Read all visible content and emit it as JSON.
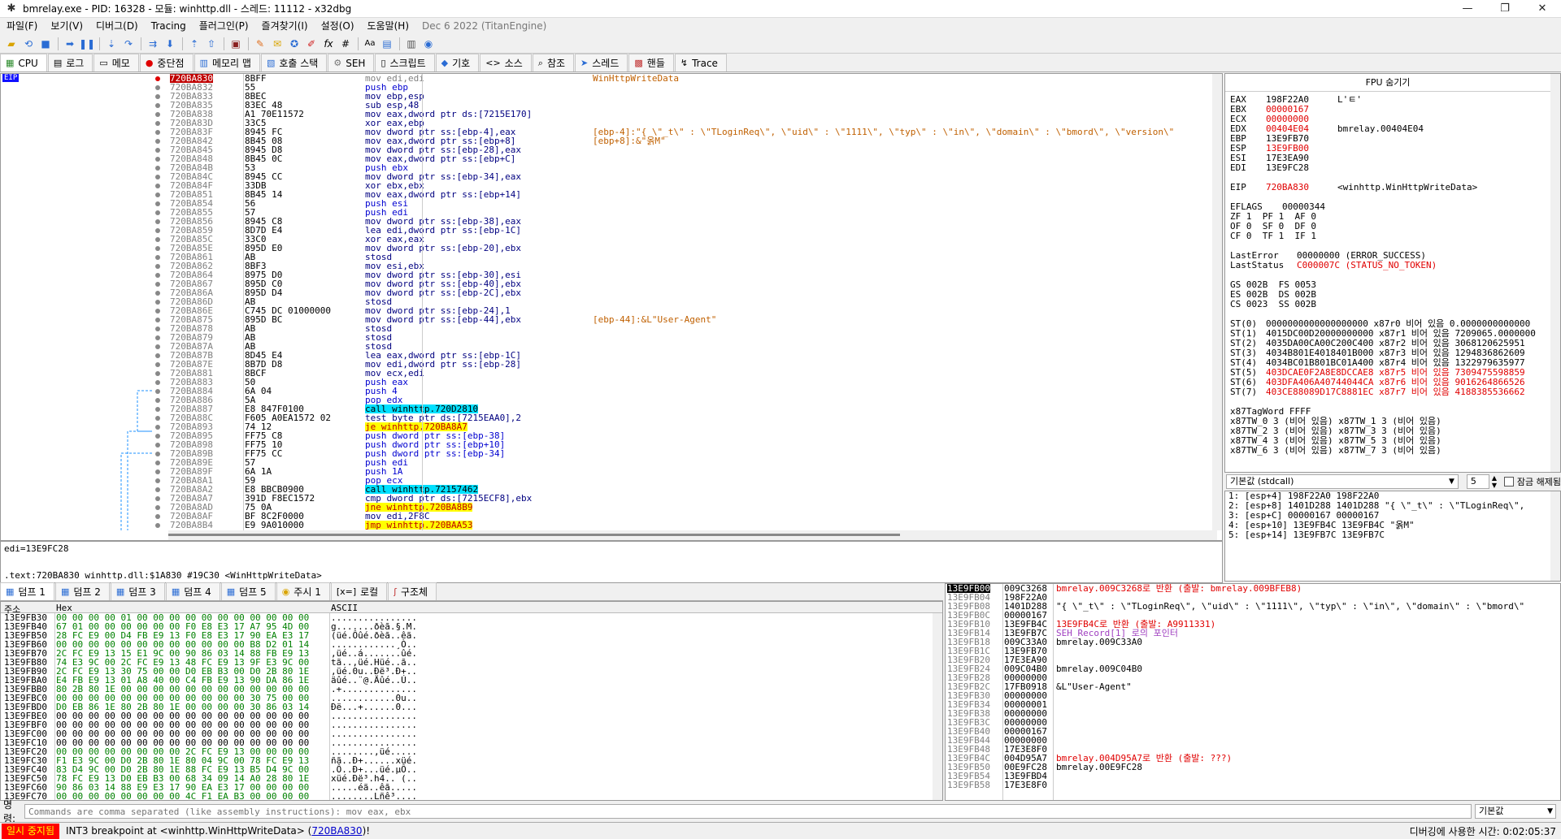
{
  "window": {
    "title": "bmrelay.exe - PID: 16328 - 모듈: winhttp.dll - 스레드: 11112 - x32dbg"
  },
  "menu": {
    "items": [
      "파일(F)",
      "보기(V)",
      "디버그(D)",
      "Tracing",
      "플러그인(P)",
      "즐겨찾기(I)",
      "설정(O)",
      "도움말(H)"
    ],
    "date": "Dec 6 2022 (TitanEngine)"
  },
  "tabs": [
    {
      "label": "CPU",
      "icon": "cpu-icon"
    },
    {
      "label": "로그",
      "icon": "log-icon"
    },
    {
      "label": "메모",
      "icon": "notes-icon"
    },
    {
      "label": "중단점",
      "icon": "breakpoint-icon"
    },
    {
      "label": "메모리 맵",
      "icon": "memory-map-icon"
    },
    {
      "label": "호출 스택",
      "icon": "call-stack-icon"
    },
    {
      "label": "SEH",
      "icon": "seh-icon"
    },
    {
      "label": "스크립트",
      "icon": "script-icon"
    },
    {
      "label": "기호",
      "icon": "symbols-icon"
    },
    {
      "label": "소스",
      "icon": "source-icon"
    },
    {
      "label": "참조",
      "icon": "references-icon"
    },
    {
      "label": "스레드",
      "icon": "threads-icon"
    },
    {
      "label": "핸들",
      "icon": "handles-icon"
    },
    {
      "label": "Trace",
      "icon": "trace-icon"
    }
  ],
  "disasm": {
    "eip_label": "EIP",
    "rows": [
      {
        "addr": "720BA830",
        "bytes": "8BFF",
        "ins": "mov edi,edi",
        "cmt": "WinHttpWriteData",
        "eip": true
      },
      {
        "addr": "720BA832",
        "bytes": "55",
        "ins": "push ebp",
        "cmt": ""
      },
      {
        "addr": "720BA833",
        "bytes": "8BEC",
        "ins": "mov ebp,esp",
        "cmt": ""
      },
      {
        "addr": "720BA835",
        "bytes": "83EC 48",
        "ins": "sub esp,48",
        "cmt": ""
      },
      {
        "addr": "720BA838",
        "bytes": "A1 70E11572",
        "ins": "mov eax,dword ptr ds:[7215E170]",
        "cmt": ""
      },
      {
        "addr": "720BA83D",
        "bytes": "33C5",
        "ins": "xor eax,ebp",
        "cmt": ""
      },
      {
        "addr": "720BA83F",
        "bytes": "8945 FC",
        "ins": "mov dword ptr ss:[ebp-4],eax",
        "cmt": "[ebp-4]:\"{ \\\"_t\\\" : \\\"TLoginReq\\\", \\\"uid\\\" : \\\"1111\\\", \\\"typ\\\" : \\\"in\\\", \\\"domain\\\" : \\\"bmord\\\", \\\"version\\\""
      },
      {
        "addr": "720BA842",
        "bytes": "8B45 08",
        "ins": "mov eax,dword ptr ss:[ebp+8]",
        "cmt": "[ebp+8]:&\"옭M\""
      },
      {
        "addr": "720BA845",
        "bytes": "8945 D8",
        "ins": "mov dword ptr ss:[ebp-28],eax",
        "cmt": ""
      },
      {
        "addr": "720BA848",
        "bytes": "8B45 0C",
        "ins": "mov eax,dword ptr ss:[ebp+C]",
        "cmt": ""
      },
      {
        "addr": "720BA84B",
        "bytes": "53",
        "ins": "push ebx",
        "cmt": ""
      },
      {
        "addr": "720BA84C",
        "bytes": "8945 CC",
        "ins": "mov dword ptr ss:[ebp-34],eax",
        "cmt": ""
      },
      {
        "addr": "720BA84F",
        "bytes": "33DB",
        "ins": "xor ebx,ebx",
        "cmt": ""
      },
      {
        "addr": "720BA851",
        "bytes": "8B45 14",
        "ins": "mov eax,dword ptr ss:[ebp+14]",
        "cmt": ""
      },
      {
        "addr": "720BA854",
        "bytes": "56",
        "ins": "push esi",
        "cmt": ""
      },
      {
        "addr": "720BA855",
        "bytes": "57",
        "ins": "push edi",
        "cmt": ""
      },
      {
        "addr": "720BA856",
        "bytes": "8945 C8",
        "ins": "mov dword ptr ss:[ebp-38],eax",
        "cmt": ""
      },
      {
        "addr": "720BA859",
        "bytes": "8D7D E4",
        "ins": "lea edi,dword ptr ss:[ebp-1C]",
        "cmt": ""
      },
      {
        "addr": "720BA85C",
        "bytes": "33C0",
        "ins": "xor eax,eax",
        "cmt": ""
      },
      {
        "addr": "720BA85E",
        "bytes": "895D E0",
        "ins": "mov dword ptr ss:[ebp-20],ebx",
        "cmt": ""
      },
      {
        "addr": "720BA861",
        "bytes": "AB",
        "ins": "stosd",
        "cmt": ""
      },
      {
        "addr": "720BA862",
        "bytes": "8BF3",
        "ins": "mov esi,ebx",
        "cmt": ""
      },
      {
        "addr": "720BA864",
        "bytes": "8975 D0",
        "ins": "mov dword ptr ss:[ebp-30],esi",
        "cmt": ""
      },
      {
        "addr": "720BA867",
        "bytes": "895D C0",
        "ins": "mov dword ptr ss:[ebp-40],ebx",
        "cmt": ""
      },
      {
        "addr": "720BA86A",
        "bytes": "895D D4",
        "ins": "mov dword ptr ss:[ebp-2C],ebx",
        "cmt": ""
      },
      {
        "addr": "720BA86D",
        "bytes": "AB",
        "ins": "stosd",
        "cmt": ""
      },
      {
        "addr": "720BA86E",
        "bytes": "C745 DC 01000000",
        "ins": "mov dword ptr ss:[ebp-24],1",
        "cmt": ""
      },
      {
        "addr": "720BA875",
        "bytes": "895D BC",
        "ins": "mov dword ptr ss:[ebp-44],ebx",
        "cmt": "[ebp-44]:&L\"User-Agent\""
      },
      {
        "addr": "720BA878",
        "bytes": "AB",
        "ins": "stosd",
        "cmt": ""
      },
      {
        "addr": "720BA879",
        "bytes": "AB",
        "ins": "stosd",
        "cmt": ""
      },
      {
        "addr": "720BA87A",
        "bytes": "AB",
        "ins": "stosd",
        "cmt": ""
      },
      {
        "addr": "720BA87B",
        "bytes": "8D45 E4",
        "ins": "lea eax,dword ptr ss:[ebp-1C]",
        "cmt": ""
      },
      {
        "addr": "720BA87E",
        "bytes": "8B7D D8",
        "ins": "mov edi,dword ptr ss:[ebp-28]",
        "cmt": ""
      },
      {
        "addr": "720BA881",
        "bytes": "8BCF",
        "ins": "mov ecx,edi",
        "cmt": ""
      },
      {
        "addr": "720BA883",
        "bytes": "50",
        "ins": "push eax",
        "cmt": ""
      },
      {
        "addr": "720BA884",
        "bytes": "6A 04",
        "ins": "push 4",
        "cmt": ""
      },
      {
        "addr": "720BA886",
        "bytes": "5A",
        "ins": "pop edx",
        "cmt": ""
      },
      {
        "addr": "720BA887",
        "bytes": "E8 847F0100",
        "ins": "call winhttp.720D2810",
        "cmt": "",
        "kind": "call"
      },
      {
        "addr": "720BA88C",
        "bytes": "F605 A0EA1572 02",
        "ins": "test byte ptr ds:[7215EAA0],2",
        "cmt": ""
      },
      {
        "addr": "720BA893",
        "bytes": "74 12",
        "ins": "je winhttp.720BA8A7",
        "cmt": "",
        "kind": "jmp"
      },
      {
        "addr": "720BA895",
        "bytes": "FF75 C8",
        "ins": "push dword ptr ss:[ebp-38]",
        "cmt": ""
      },
      {
        "addr": "720BA898",
        "bytes": "FF75 10",
        "ins": "push dword ptr ss:[ebp+10]",
        "cmt": ""
      },
      {
        "addr": "720BA89B",
        "bytes": "FF75 CC",
        "ins": "push dword ptr ss:[ebp-34]",
        "cmt": ""
      },
      {
        "addr": "720BA89E",
        "bytes": "57",
        "ins": "push edi",
        "cmt": ""
      },
      {
        "addr": "720BA89F",
        "bytes": "6A 1A",
        "ins": "push 1A",
        "cmt": ""
      },
      {
        "addr": "720BA8A1",
        "bytes": "59",
        "ins": "pop ecx",
        "cmt": ""
      },
      {
        "addr": "720BA8A2",
        "bytes": "E8 BBCB0900",
        "ins": "call winhttp.72157462",
        "cmt": "",
        "kind": "call"
      },
      {
        "addr": "720BA8A7",
        "bytes": "391D F8EC1572",
        "ins": "cmp dword ptr ds:[7215ECF8],ebx",
        "cmt": ""
      },
      {
        "addr": "720BA8AD",
        "bytes": "75 0A",
        "ins": "jne winhttp.720BA8B9",
        "cmt": "",
        "kind": "jmp"
      },
      {
        "addr": "720BA8AF",
        "bytes": "BF 8C2F0000",
        "ins": "mov edi,2F8C",
        "cmt": ""
      },
      {
        "addr": "720BA8B4",
        "bytes": "E9 9A010000",
        "ins": "jmp winhttp.720BAA53",
        "cmt": "",
        "kind": "jmp"
      }
    ]
  },
  "info": {
    "line1": "edi=13E9FC28",
    "line2": ".text:720BA830 winhttp.dll:$1A830 #19C30 <WinHttpWriteData>"
  },
  "regs": {
    "header": "FPU 숨기기",
    "lines": [
      {
        "name": "EAX",
        "val": "198F22A0",
        "cmt": "L'ㅌ'",
        "red": false
      },
      {
        "name": "EBX",
        "val": "00000167",
        "cmt": "",
        "red": true
      },
      {
        "name": "ECX",
        "val": "00000000",
        "cmt": "",
        "red": true
      },
      {
        "name": "EDX",
        "val": "00404E04",
        "cmt": "bmrelay.00404E04",
        "red": true
      },
      {
        "name": "EBP",
        "val": "13E9FB70",
        "cmt": "",
        "red": false
      },
      {
        "name": "ESP",
        "val": "13E9FB00",
        "cmt": "",
        "red": true
      },
      {
        "name": "ESI",
        "val": "17E3EA90",
        "cmt": "",
        "red": false
      },
      {
        "name": "EDI",
        "val": "13E9FC28",
        "cmt": "",
        "red": false
      },
      {
        "name": "",
        "val": "",
        "cmt": "",
        "red": false
      },
      {
        "name": "EIP",
        "val": "720BA830",
        "cmt": "<winhttp.WinHttpWriteData>",
        "red": true
      }
    ],
    "eflags": {
      "label": "EFLAGS",
      "val": "00000344"
    },
    "flags": [
      "ZF 1  PF 1  AF 0",
      "OF 0  SF 0  DF 0",
      "CF 0  TF 1  IF 1"
    ],
    "lasterror": {
      "label": "LastError",
      "val": "00000000 (ERROR_SUCCESS)"
    },
    "laststatus": {
      "label": "LastStatus",
      "val": "C000007C (STATUS_NO_TOKEN)"
    },
    "segs": [
      "GS 002B  FS 0053",
      "ES 002B  DS 002B",
      "CS 0023  SS 002B"
    ],
    "st": [
      {
        "val": "0000000000000000000 x87r0 비어 있음 0.0000000000000",
        "red": false
      },
      {
        "val": "4015DC00D20000000000 x87r1 비어 있음 7209065.0000000",
        "red": false
      },
      {
        "val": "4035DA00CA00C200C400 x87r2 비어 있음 3068120625951",
        "red": false
      },
      {
        "val": "4034B801E4018401B000 x87r3 비어 있음 1294836862609",
        "red": false
      },
      {
        "val": "4034BC01B801BC01A400 x87r4 비어 있음 1322979635977",
        "red": false
      },
      {
        "val": "403DCAE0F2A8E8DCCAE8 x87r5 비어 있음 7309475598859",
        "red": true
      },
      {
        "val": "403DFA406A40744044CA x87r6 비어 있음 9016264866526",
        "red": true
      },
      {
        "val": "403CE88089D17C8881EC x87r7 비어 있음 4188385536662",
        "red": true
      }
    ],
    "tagword": "x87TagWord FFFF",
    "tw": [
      "x87TW_0 3 (비어 있음) x87TW_1 3 (비어 있음)",
      "x87TW_2 3 (비어 있음) x87TW_3 3 (비어 있음)",
      "x87TW_4 3 (비어 있음) x87TW_5 3 (비어 있음)",
      "x87TW_6 3 (비어 있음) x87TW_7 3 (비어 있음)"
    ]
  },
  "callconv": {
    "selected": "기본값 (stdcall)",
    "count": "5",
    "lock_label": "잠금 해제됨"
  },
  "args": [
    "1: [esp+4] 198F22A0 198F22A0",
    "2: [esp+8] 1401D288 1401D288 \"{ \\\"_t\\\" : \\\"TLoginReq\\\",",
    "3: [esp+C] 00000167 00000167",
    "4: [esp+10] 13E9FB4C 13E9FB4C \"옭M\"",
    "5: [esp+14] 13E9FB7C 13E9FB7C"
  ],
  "dumptabs": [
    {
      "label": "덤프 1",
      "icon": "dump-icon"
    },
    {
      "label": "덤프 2",
      "icon": "dump-icon"
    },
    {
      "label": "덤프 3",
      "icon": "dump-icon"
    },
    {
      "label": "덤프 4",
      "icon": "dump-icon"
    },
    {
      "label": "덤프 5",
      "icon": "dump-icon"
    },
    {
      "label": "주시 1",
      "icon": "watch-icon"
    },
    {
      "label": "로컬",
      "icon": "locals-icon"
    },
    {
      "label": "구조체",
      "icon": "struct-icon"
    }
  ],
  "dump": {
    "headers": {
      "addr": "주소",
      "hex": "Hex",
      "ascii": "ASCII"
    },
    "rows": [
      {
        "addr": "13E9FB30",
        "hex": "00 00 00 00 01 00 00 00 00 00 00 00 00 00 00 00",
        "asc": "................"
      },
      {
        "addr": "13E9FB40",
        "hex": "67 01 00 00 00 00 00 00 F0 E8 E3 17 A7 95 4D 00",
        "asc": "g.......ðèã.§.M."
      },
      {
        "addr": "13E9FB50",
        "hex": "28 FC E9 00 D4 FB E9 13 F0 E8 E3 17 90 EA E3 17",
        "asc": "(üé.Ôûé.ðèã..êã."
      },
      {
        "addr": "13E9FB60",
        "hex": "00 00 00 00 00 00 00 00 00 00 00 00 B8 D2 01 14",
        "asc": "............¸Ò.."
      },
      {
        "addr": "13E9FB70",
        "hex": "2C FC E9 13 15 E1 9C 00 90 86 03 14 88 FB E9 13",
        "asc": ",üé..á.......ûé."
      },
      {
        "addr": "13E9FB80",
        "hex": "74 E3 9C 00 2C FC E9 13 48 FC E9 13 9F E3 9C 00",
        "asc": "tã..,üé.Hüé..ã.."
      },
      {
        "addr": "13E9FB90",
        "hex": "2C FC E9 13 30 75 00 00 D0 EB B3 00 D0 2B 80 1E",
        "asc": ",üé.0u..Ðë³.Ð+.."
      },
      {
        "addr": "13E9FBA0",
        "hex": "E4 FB E9 13 01 A8 40 00 C4 FB E9 13 90 DA 86 1E",
        "asc": "äûé..¨@.Äûé..Ú.."
      },
      {
        "addr": "13E9FBB0",
        "hex": "80 2B 80 1E 00 00 00 00 00 00 00 00 00 00 00 00",
        "asc": ".+.............."
      },
      {
        "addr": "13E9FBC0",
        "hex": "00 00 00 00 00 00 00 00 00 00 00 00 30 75 00 00",
        "asc": "............0u.."
      },
      {
        "addr": "13E9FBD0",
        "hex": "D0 EB 86 1E 80 2B 80 1E 00 00 00 00 30 86 03 14",
        "asc": "Ðë...+......0..."
      },
      {
        "addr": "13E9FBE0",
        "hex": "00 00 00 00 00 00 00 00 00 00 00 00 00 00 00 00",
        "asc": "................"
      },
      {
        "addr": "13E9FBF0",
        "hex": "00 00 00 00 00 00 00 00 00 00 00 00 00 00 00 00",
        "asc": "................"
      },
      {
        "addr": "13E9FC00",
        "hex": "00 00 00 00 00 00 00 00 00 00 00 00 00 00 00 00",
        "asc": "................"
      },
      {
        "addr": "13E9FC10",
        "hex": "00 00 00 00 00 00 00 00 00 00 00 00 00 00 00 00",
        "asc": "................"
      },
      {
        "addr": "13E9FC20",
        "hex": "00 00 00 00 00 00 00 00 2C FC E9 13 00 00 00 00",
        "asc": "........,üé....."
      },
      {
        "addr": "13E9FC30",
        "hex": "F1 E3 9C 00 D0 2B 80 1E 80 04 9C 00 78 FC E9 13",
        "asc": "ñã..Ð+......xüé."
      },
      {
        "addr": "13E9FC40",
        "hex": "83 D4 9C 00 D0 2B 80 1E 88 FC E9 13 B5 D4 9C 00",
        "asc": ".Ô..Ð+...üé.µÔ.."
      },
      {
        "addr": "13E9FC50",
        "hex": "78 FC E9 13 D0 EB B3 00 68 34 09 14 A0 28 80 1E",
        "asc": "xüé.Ðë³.h4.. (.."
      },
      {
        "addr": "13E9FC60",
        "hex": "90 86 03 14 88 E9 E3 17 90 EA E3 17 00 00 00 00",
        "asc": ".....éã..êã....."
      },
      {
        "addr": "13E9FC70",
        "hex": "00 00 00 00 00 00 00 00 4C F1 EA B3 00 00 00 00",
        "asc": "........Lñê³...."
      }
    ]
  },
  "stack": {
    "rows": [
      {
        "addr": "13E9FB00",
        "val": "009C3268",
        "cmt": "bmrelay.009C3268로 반환 (출발: bmrelay.009BFEB8)",
        "style": "red",
        "top": true
      },
      {
        "addr": "13E9FB04",
        "val": "198F22A0",
        "cmt": "",
        "style": ""
      },
      {
        "addr": "13E9FB08",
        "val": "1401D288",
        "cmt": "\"{ \\\"_t\\\" : \\\"TLoginReq\\\", \\\"uid\\\" : \\\"1111\\\", \\\"typ\\\" : \\\"in\\\", \\\"domain\\\" : \\\"bmord\\\"",
        "style": ""
      },
      {
        "addr": "13E9FB0C",
        "val": "00000167",
        "cmt": "",
        "style": ""
      },
      {
        "addr": "13E9FB10",
        "val": "13E9FB4C",
        "cmt": "13E9FB4C로 반환 (출발: A9911331)",
        "style": "red"
      },
      {
        "addr": "13E9FB14",
        "val": "13E9FB7C",
        "cmt": "SEH_Record[1] 로의 포인터",
        "style": "purple"
      },
      {
        "addr": "13E9FB18",
        "val": "009C33A0",
        "cmt": "bmrelay.009C33A0",
        "style": ""
      },
      {
        "addr": "13E9FB1C",
        "val": "13E9FB70",
        "cmt": "",
        "style": ""
      },
      {
        "addr": "13E9FB20",
        "val": "17E3EA90",
        "cmt": "",
        "style": ""
      },
      {
        "addr": "13E9FB24",
        "val": "009C04B0",
        "cmt": "bmrelay.009C04B0",
        "style": ""
      },
      {
        "addr": "13E9FB28",
        "val": "00000000",
        "cmt": "",
        "style": ""
      },
      {
        "addr": "13E9FB2C",
        "val": "17FB0918",
        "cmt": "&L\"User-Agent\"",
        "style": ""
      },
      {
        "addr": "13E9FB30",
        "val": "00000000",
        "cmt": "",
        "style": ""
      },
      {
        "addr": "13E9FB34",
        "val": "00000001",
        "cmt": "",
        "style": ""
      },
      {
        "addr": "13E9FB38",
        "val": "00000000",
        "cmt": "",
        "style": ""
      },
      {
        "addr": "13E9FB3C",
        "val": "00000000",
        "cmt": "",
        "style": ""
      },
      {
        "addr": "13E9FB40",
        "val": "00000167",
        "cmt": "",
        "style": ""
      },
      {
        "addr": "13E9FB44",
        "val": "00000000",
        "cmt": "",
        "style": ""
      },
      {
        "addr": "13E9FB48",
        "val": "17E3E8F0",
        "cmt": "",
        "style": ""
      },
      {
        "addr": "13E9FB4C",
        "val": "004D95A7",
        "cmt": "bmrelay.004D95A7로 반환 (출발: ???)",
        "style": "red"
      },
      {
        "addr": "13E9FB50",
        "val": "00E9FC28",
        "cmt": "bmrelay.00E9FC28",
        "style": ""
      },
      {
        "addr": "13E9FB54",
        "val": "13E9FBD4",
        "cmt": "",
        "style": ""
      },
      {
        "addr": "13E9FB58",
        "val": "17E3E8F0",
        "cmt": "",
        "style": ""
      }
    ]
  },
  "command": {
    "label": "명령:",
    "placeholder": "Commands are comma separated (like assembly instructions): mov eax, ebx",
    "default": "기본값"
  },
  "status": {
    "paused": "일시 중지됨",
    "message": "INT3 breakpoint at <winhttp.WinHttpWriteData> (",
    "link": "720BA830",
    "message_end": ")!",
    "right": "디버깅에 사용한 시간: 0:02:05:37"
  }
}
